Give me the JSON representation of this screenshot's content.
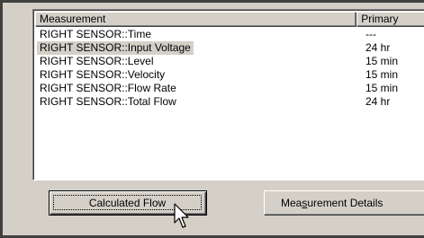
{
  "list": {
    "columns": [
      "Measurement",
      "Primary"
    ],
    "rows": [
      {
        "measurement": "RIGHT SENSOR::Time",
        "primary": "---",
        "selected": false
      },
      {
        "measurement": "RIGHT SENSOR::Input Voltage",
        "primary": "24 hr",
        "selected": true
      },
      {
        "measurement": "RIGHT SENSOR::Level",
        "primary": "15 min",
        "selected": false
      },
      {
        "measurement": "RIGHT SENSOR::Velocity",
        "primary": "15 min",
        "selected": false
      },
      {
        "measurement": "RIGHT SENSOR::Flow Rate",
        "primary": "15 min",
        "selected": false
      },
      {
        "measurement": "RIGHT SENSOR::Total Flow",
        "primary": "24 hr",
        "selected": false
      }
    ]
  },
  "buttons": {
    "calculated_flow": "Calculated Flow",
    "measurement_details_pre": "Mea",
    "measurement_details_ul": "s",
    "measurement_details_post": "urement Details"
  },
  "colors": {
    "face": "#d4d0c8",
    "window": "#ffffff",
    "shadow": "#808080",
    "dark_shadow": "#404040"
  },
  "icons": {
    "cursor": "arrow-pointer-icon"
  }
}
